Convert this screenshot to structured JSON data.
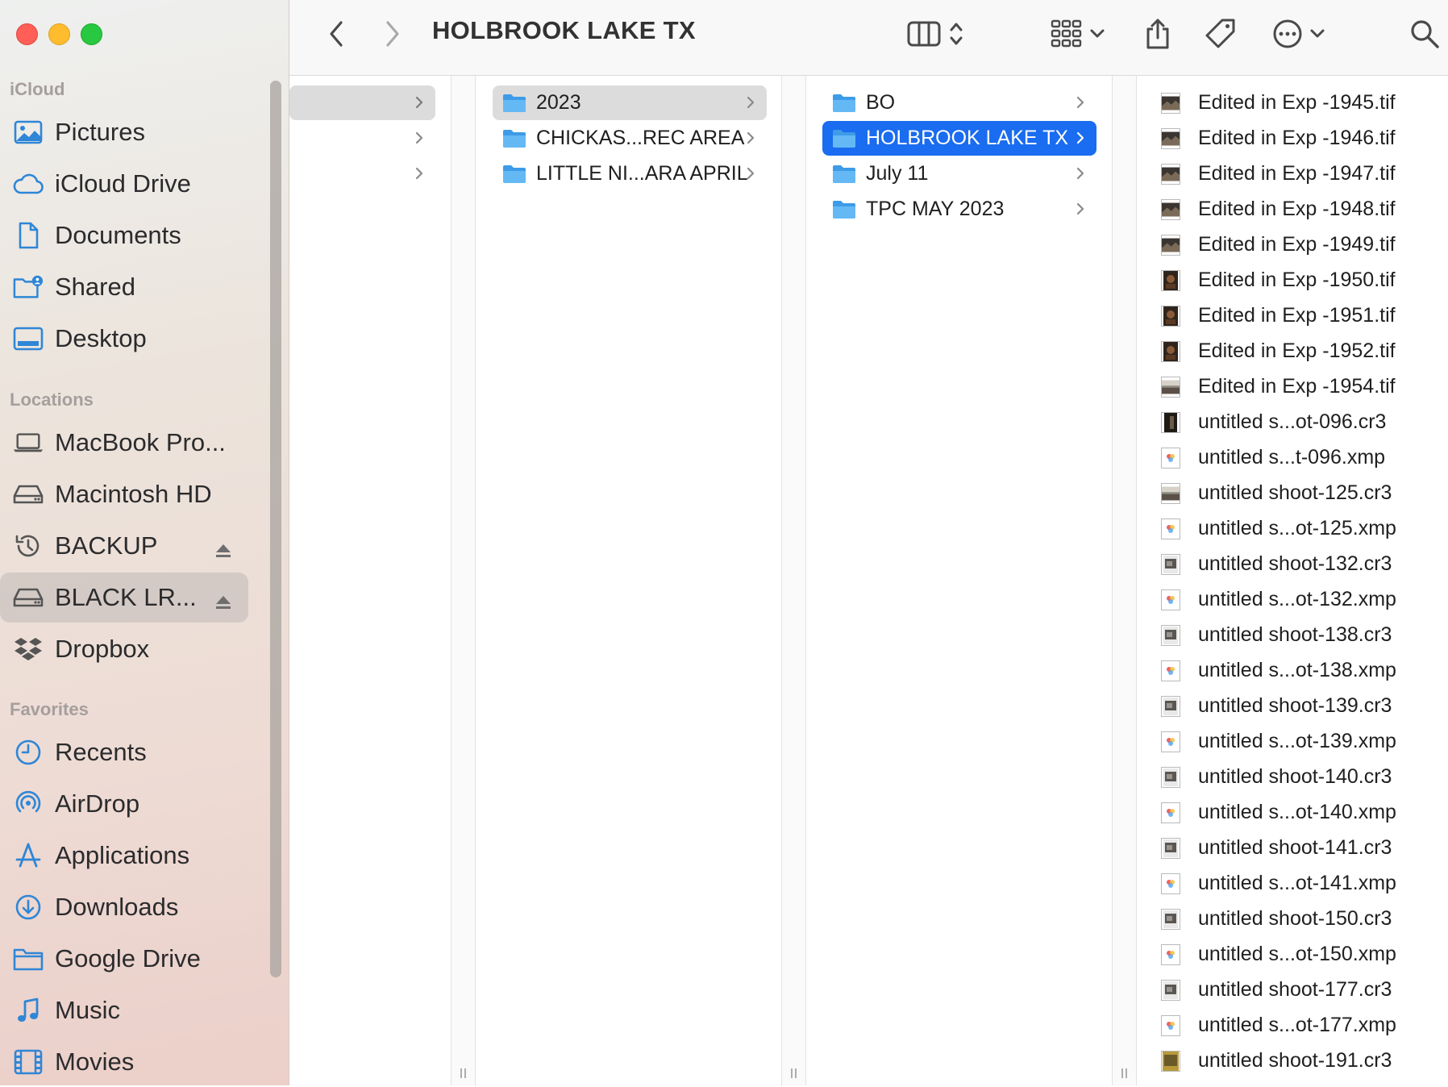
{
  "window": {
    "title": "HOLBROOK LAKE TX"
  },
  "sidebar": {
    "sections": [
      {
        "title": "iCloud",
        "items": [
          {
            "label": "Pictures",
            "icon": "photo-icon"
          },
          {
            "label": "iCloud Drive",
            "icon": "cloud-icon"
          },
          {
            "label": "Documents",
            "icon": "document-icon"
          },
          {
            "label": "Shared",
            "icon": "shared-folder-icon"
          },
          {
            "label": "Desktop",
            "icon": "desktop-icon"
          }
        ]
      },
      {
        "title": "Locations",
        "items": [
          {
            "label": "MacBook Pro...",
            "icon": "laptop-icon"
          },
          {
            "label": "Macintosh HD",
            "icon": "drive-icon"
          },
          {
            "label": "BACKUP",
            "icon": "time-machine-icon",
            "eject": true
          },
          {
            "label": "BLACK LR...",
            "icon": "drive-icon",
            "eject": true,
            "selected": true
          },
          {
            "label": "Dropbox",
            "icon": "dropbox-icon"
          }
        ]
      },
      {
        "title": "Favorites",
        "items": [
          {
            "label": "Recents",
            "icon": "clock-icon"
          },
          {
            "label": "AirDrop",
            "icon": "airdrop-icon"
          },
          {
            "label": "Applications",
            "icon": "applications-icon"
          },
          {
            "label": "Downloads",
            "icon": "download-icon"
          },
          {
            "label": "Google Drive",
            "icon": "folder-icon"
          },
          {
            "label": "Music",
            "icon": "music-icon"
          },
          {
            "label": "Movies",
            "icon": "film-icon"
          }
        ]
      }
    ]
  },
  "columns": {
    "col2": [
      {
        "label": "2023",
        "selected": "grey"
      },
      {
        "label": "CHICKAS...REC AREA"
      },
      {
        "label": "LITTLE NI...ARA APRIL"
      }
    ],
    "col3": [
      {
        "label": "BO"
      },
      {
        "label": "HOLBROOK LAKE TX",
        "selected": "blue"
      },
      {
        "label": "July 11"
      },
      {
        "label": "TPC MAY 2023"
      }
    ],
    "files": [
      {
        "name": "Edited in Exp -1945.tif",
        "kind": "landscape"
      },
      {
        "name": "Edited in Exp -1946.tif",
        "kind": "landscape"
      },
      {
        "name": "Edited in Exp -1947.tif",
        "kind": "landscape"
      },
      {
        "name": "Edited in Exp -1948.tif",
        "kind": "landscape"
      },
      {
        "name": "Edited in Exp -1949.tif",
        "kind": "landscape"
      },
      {
        "name": "Edited in Exp -1950.tif",
        "kind": "portrait"
      },
      {
        "name": "Edited in Exp -1951.tif",
        "kind": "portrait"
      },
      {
        "name": "Edited in Exp -1952.tif",
        "kind": "portrait"
      },
      {
        "name": "Edited in Exp -1954.tif",
        "kind": "landscape-light"
      },
      {
        "name": "untitled s...ot-096.cr3",
        "kind": "portrait-dark"
      },
      {
        "name": "untitled s...t-096.xmp",
        "kind": "xmp"
      },
      {
        "name": "untitled shoot-125.cr3",
        "kind": "landscape-light"
      },
      {
        "name": "untitled s...ot-125.xmp",
        "kind": "xmp"
      },
      {
        "name": "untitled shoot-132.cr3",
        "kind": "raw"
      },
      {
        "name": "untitled s...ot-132.xmp",
        "kind": "xmp"
      },
      {
        "name": "untitled shoot-138.cr3",
        "kind": "raw"
      },
      {
        "name": "untitled s...ot-138.xmp",
        "kind": "xmp"
      },
      {
        "name": "untitled shoot-139.cr3",
        "kind": "raw"
      },
      {
        "name": "untitled s...ot-139.xmp",
        "kind": "xmp"
      },
      {
        "name": "untitled shoot-140.cr3",
        "kind": "raw"
      },
      {
        "name": "untitled s...ot-140.xmp",
        "kind": "xmp"
      },
      {
        "name": "untitled shoot-141.cr3",
        "kind": "raw"
      },
      {
        "name": "untitled s...ot-141.xmp",
        "kind": "xmp"
      },
      {
        "name": "untitled shoot-150.cr3",
        "kind": "raw"
      },
      {
        "name": "untitled s...ot-150.xmp",
        "kind": "xmp"
      },
      {
        "name": "untitled shoot-177.cr3",
        "kind": "raw"
      },
      {
        "name": "untitled s...ot-177.xmp",
        "kind": "xmp"
      },
      {
        "name": "untitled shoot-191.cr3",
        "kind": "raw-yellow"
      }
    ]
  },
  "colors": {
    "accent": "#1a6cf0",
    "folder": "#5ab4f0",
    "sidebar_icon": "#2f86d6"
  }
}
